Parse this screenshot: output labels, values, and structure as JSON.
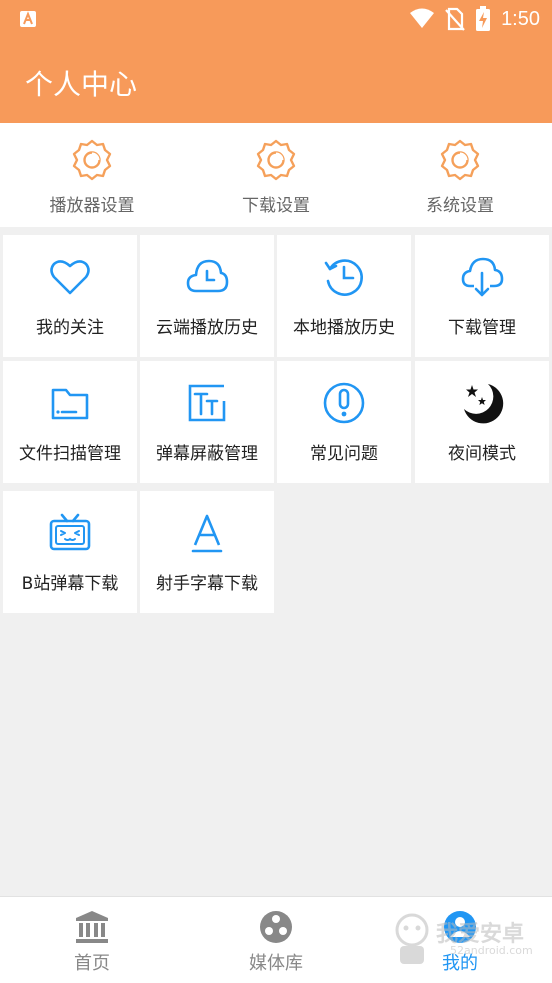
{
  "status_bar": {
    "time": "1:50",
    "app_icon": "a-icon",
    "icons": [
      "wifi-icon",
      "no-sim-icon",
      "battery-charging-icon"
    ]
  },
  "app_bar": {
    "title": "个人中心"
  },
  "colors": {
    "accent": "#f79a5a",
    "icon_blue": "#2196f3",
    "gear_orange": "#f5a05a"
  },
  "settings": [
    {
      "label": "播放器设置",
      "icon": "gear-icon"
    },
    {
      "label": "下载设置",
      "icon": "gear-icon"
    },
    {
      "label": "系统设置",
      "icon": "gear-icon"
    }
  ],
  "grid": [
    {
      "label": "我的关注",
      "icon": "heart-icon"
    },
    {
      "label": "云端播放历史",
      "icon": "cloud-clock-icon"
    },
    {
      "label": "本地播放历史",
      "icon": "history-clock-icon"
    },
    {
      "label": "下载管理",
      "icon": "cloud-download-icon"
    },
    {
      "label": "文件扫描管理",
      "icon": "folder-icon"
    },
    {
      "label": "弹幕屏蔽管理",
      "icon": "text-block-icon"
    },
    {
      "label": "常见问题",
      "icon": "exclamation-icon"
    },
    {
      "label": "夜间模式",
      "icon": "moon-stars-icon"
    },
    {
      "label": "B站弹幕下载",
      "icon": "tv-icon"
    },
    {
      "label": "射手字幕下载",
      "icon": "letter-a-icon"
    }
  ],
  "bottom_nav": [
    {
      "label": "首页",
      "icon": "bank-icon",
      "active": false
    },
    {
      "label": "媒体库",
      "icon": "film-reel-icon",
      "active": false
    },
    {
      "label": "我的",
      "icon": "user-icon",
      "active": true
    }
  ],
  "watermark": {
    "text": "我爱安卓",
    "sub": "52android.com"
  }
}
